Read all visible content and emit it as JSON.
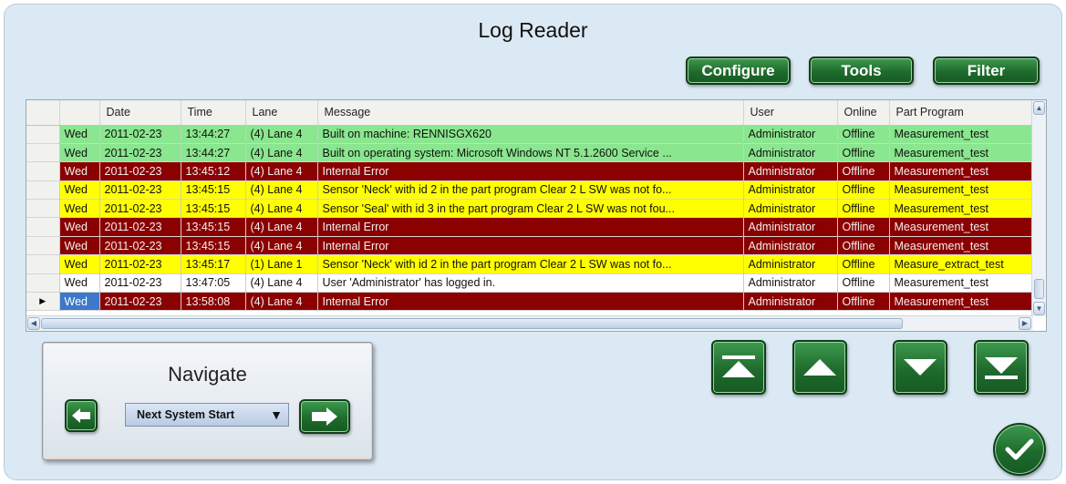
{
  "window": {
    "title": "Log Reader"
  },
  "toolbar": {
    "configure_label": "Configure",
    "tools_label": "Tools",
    "filter_label": "Filter"
  },
  "grid": {
    "columns": [
      "",
      "Date",
      "Time",
      "Lane",
      "Message",
      "User",
      "Online",
      "Part Program"
    ],
    "current_row_marker": "▶",
    "rows": [
      {
        "status": "green",
        "day": "Wed",
        "date": "2011-02-23",
        "time": "13:44:27",
        "lane": "(4) Lane 4",
        "message": "Built on machine: RENNISGX620",
        "user": "Administrator",
        "online": "Offline",
        "program": "Measurement_test"
      },
      {
        "status": "green",
        "day": "Wed",
        "date": "2011-02-23",
        "time": "13:44:27",
        "lane": "(4) Lane 4",
        "message": "Built on operating system: Microsoft Windows NT 5.1.2600 Service ...",
        "user": "Administrator",
        "online": "Offline",
        "program": "Measurement_test"
      },
      {
        "status": "red",
        "day": "Wed",
        "date": "2011-02-23",
        "time": "13:45:12",
        "lane": "(4) Lane 4",
        "message": "Internal Error",
        "user": "Administrator",
        "online": "Offline",
        "program": "Measurement_test"
      },
      {
        "status": "yellow",
        "day": "Wed",
        "date": "2011-02-23",
        "time": "13:45:15",
        "lane": "(4) Lane 4",
        "message": "Sensor 'Neck' with id 2 in the part program Clear 2 L SW was not fo...",
        "user": "Administrator",
        "online": "Offline",
        "program": "Measurement_test"
      },
      {
        "status": "yellow",
        "day": "Wed",
        "date": "2011-02-23",
        "time": "13:45:15",
        "lane": "(4) Lane 4",
        "message": "Sensor 'Seal' with id 3 in the part program Clear 2 L SW was not fou...",
        "user": "Administrator",
        "online": "Offline",
        "program": "Measurement_test"
      },
      {
        "status": "red",
        "day": "Wed",
        "date": "2011-02-23",
        "time": "13:45:15",
        "lane": "(4) Lane 4",
        "message": "Internal Error",
        "user": "Administrator",
        "online": "Offline",
        "program": "Measurement_test"
      },
      {
        "status": "red",
        "day": "Wed",
        "date": "2011-02-23",
        "time": "13:45:15",
        "lane": "(4) Lane 4",
        "message": "Internal Error",
        "user": "Administrator",
        "online": "Offline",
        "program": "Measurement_test"
      },
      {
        "status": "yellow",
        "day": "Wed",
        "date": "2011-02-23",
        "time": "13:45:17",
        "lane": "(1) Lane 1",
        "message": "Sensor 'Neck' with id 2 in the part program Clear 2 L SW was not fo...",
        "user": "Administrator",
        "online": "Offline",
        "program": "Measure_extract_test"
      },
      {
        "status": "white",
        "day": "Wed",
        "date": "2011-02-23",
        "time": "13:47:05",
        "lane": "(4) Lane 4",
        "message": "User 'Administrator' has logged in.",
        "user": "Administrator",
        "online": "Offline",
        "program": "Measurement_test"
      },
      {
        "status": "red",
        "day": "Wed",
        "date": "2011-02-23",
        "time": "13:58:08",
        "lane": "(4) Lane 4",
        "message": "Internal Error",
        "user": "Administrator",
        "online": "Offline",
        "program": "Measurement_test"
      }
    ]
  },
  "navigate": {
    "title": "Navigate",
    "selected_option": "Next System Start"
  },
  "colors": {
    "green_row": "#8ae68f",
    "red_row": "#8b0000",
    "yellow_row": "#ffff00",
    "button_green": "#1f6b2d",
    "selected_cell": "#3d78c9"
  },
  "icons": {
    "prev": "arrow-left-icon",
    "next": "arrow-right-icon",
    "first": "jump-to-first-icon",
    "up": "triangle-up-icon",
    "down": "triangle-down-icon",
    "last": "jump-to-last-icon",
    "ok": "checkmark-icon"
  }
}
